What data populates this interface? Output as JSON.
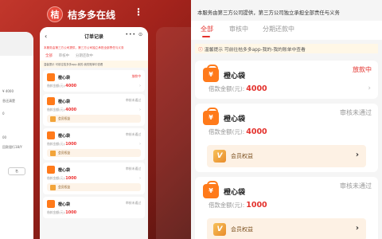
{
  "switcher": {
    "app_icon_char": "桔",
    "app_name": "桔多多在线",
    "more_icon": "⋮",
    "prev_app_lines": [
      "¥ 4000",
      "息还清楚",
      "0",
      "00",
      "回款银行18/Y",
      "名"
    ],
    "prev_app_button": "名",
    "card": {
      "back_icon": "‹",
      "title": "订单记录",
      "caps": "••• ⊙",
      "notice": "本服务由第三方公司提供，第三方公司独立承担全部责任与义务",
      "tabs": [
        "全部",
        "审核中",
        "分期还款中"
      ],
      "tip": "温馨提示 可前往桔多多app-我的-我的账单中查看",
      "items": [
        {
          "name": "橙心袋",
          "status": "放款中",
          "status_red": true,
          "amount_label": "借款金额(元):",
          "amount": "4000",
          "has_vip": false
        },
        {
          "name": "橙心袋",
          "status": "审核未通过",
          "status_red": false,
          "amount_label": "借款金额(元):",
          "amount": "4000",
          "has_vip": true,
          "vip_label": "会员权益"
        },
        {
          "name": "橙心袋",
          "status": "审核未通过",
          "status_red": false,
          "amount_label": "借款金额(元):",
          "amount": "1000",
          "has_vip": true,
          "vip_label": "会员权益"
        },
        {
          "name": "橙心袋",
          "status": "审核未通过",
          "status_red": false,
          "amount_label": "借款金额(元):",
          "amount": "1000",
          "has_vip": true,
          "vip_label": "会员权益"
        },
        {
          "name": "橙心袋",
          "status": "审核未通过",
          "status_red": false,
          "amount_label": "借款金额(元):",
          "amount": "1000",
          "has_vip": false
        }
      ]
    }
  },
  "page": {
    "notice": "本服务由第三方公司提供，第三方公司独立承担全部责任与义务",
    "tabs": [
      {
        "label": "全部",
        "active": true
      },
      {
        "label": "审核中",
        "active": false
      },
      {
        "label": "分期还款中",
        "active": false
      }
    ],
    "tip_icon": "ⓘ",
    "tip": "温馨提示 可前往桔多多app-我的-我的账单中查看",
    "orders": [
      {
        "name": "橙心袋",
        "status": "放款中",
        "status_red": true,
        "amount_label": "借款金额(元):",
        "amount": "4000",
        "chevron": "›"
      },
      {
        "name": "橙心袋",
        "status": "审核未通过",
        "status_red": false,
        "amount_label": "借款金额(元):",
        "amount": "4000",
        "chevron": "›",
        "vip_badge": "V",
        "vip_label": "会员权益",
        "vip_chevron": "›"
      },
      {
        "name": "橙心袋",
        "status": "审核未通过",
        "status_red": false,
        "amount_label": "借款金额(元):",
        "amount": "1000",
        "chevron": "›",
        "vip_badge": "V",
        "vip_label": "会员权益",
        "vip_chevron": "›"
      }
    ]
  },
  "colors": {
    "accent": "#e3312c",
    "bag": "#ff7a1a",
    "switcher_bg": "#a3231c",
    "vip_bg": "#fdf1e4"
  }
}
